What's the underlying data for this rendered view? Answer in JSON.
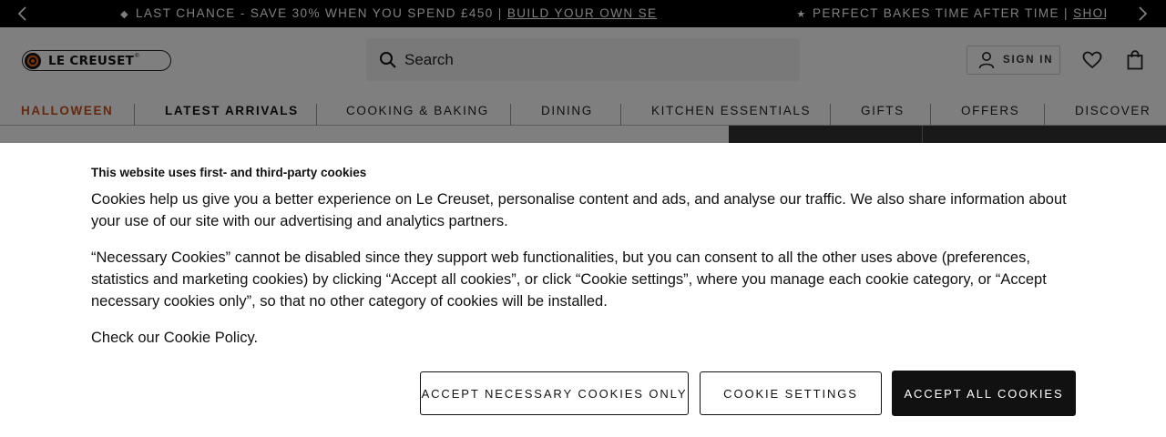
{
  "promo": {
    "message1_text": "LAST CHANCE - SAVE 30% WHEN YOU SPEND £450 | ",
    "message1_link": "BUILD YOUR OWN SET",
    "message2_text": "PERFECT BAKES TIME AFTER TIME | ",
    "message2_link": "SHOP",
    "icons": {
      "message1": "tag-icon",
      "message2": "star-icon",
      "prev": "chevron-left-icon",
      "next": "chevron-right-icon"
    }
  },
  "header": {
    "logo_text": "LE CREUSET",
    "logo_mark": "®",
    "search_placeholder": "Search",
    "signin_label": "SIGN IN"
  },
  "nav": {
    "items": [
      {
        "label": "HALLOWEEN"
      },
      {
        "label": "LATEST ARRIVALS"
      },
      {
        "label": "COOKING & BAKING"
      },
      {
        "label": "DINING"
      },
      {
        "label": "KITCHEN ESSENTIALS"
      },
      {
        "label": "GIFTS"
      },
      {
        "label": "OFFERS"
      },
      {
        "label": "DISCOVER"
      }
    ],
    "accent_color": "#c8501e"
  },
  "cookie": {
    "title": "This website uses first- and third-party cookies",
    "paragraph1": "Cookies help us give you a better experience on Le Creuset, personalise content and ads, and analyse our traffic. We also share information about your use of our site with our advertising and analytics partners.",
    "paragraph2": "“Necessary Cookies” cannot be disabled since they support web functionalities, but you can consent to all the other uses above (preferences, statistics and marketing cookies) by clicking “Accept all cookies”, or click “Cookie settings”, where you manage each cookie category, or “Accept necessary cookies only”, so that no other category of cookies will be installed.",
    "paragraph3_prefix": "Check our ",
    "paragraph3_link": "Cookie Policy",
    "paragraph3_suffix": ".",
    "buttons": {
      "necessary": "ACCEPT NECESSARY COOKIES ONLY",
      "settings": "COOKIE SETTINGS",
      "accept_all": "ACCEPT ALL COOKIES"
    }
  }
}
